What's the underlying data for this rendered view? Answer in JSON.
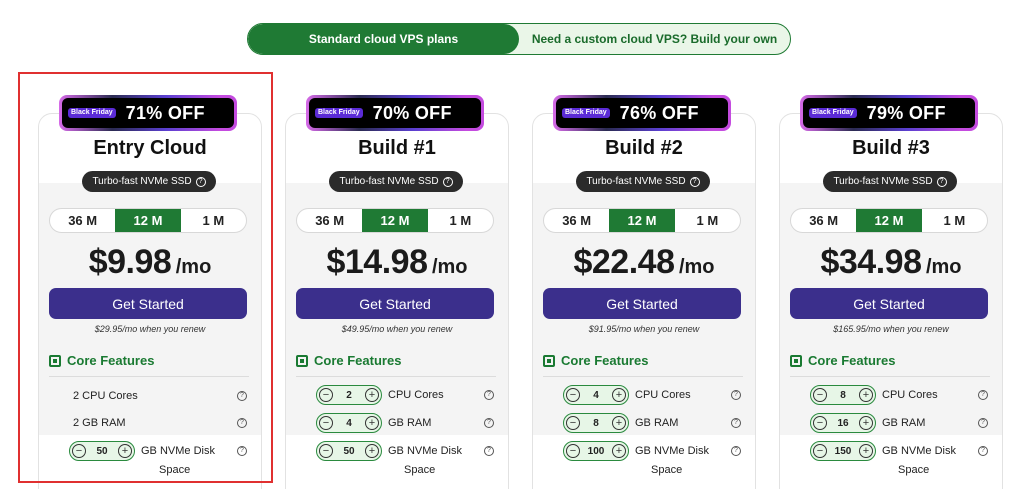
{
  "toggle": {
    "active": "Standard cloud VPS plans",
    "inactive": "Need a custom cloud VPS? Build your own"
  },
  "common": {
    "badge_label": "Black Friday",
    "ssd_label": "Turbo-fast NVMe SSD",
    "help_icon": "?",
    "terms": [
      "36 M",
      "12 M",
      "1 M"
    ],
    "selected_term": "12 M",
    "per_mo": "/mo",
    "cta": "Get Started",
    "core_features": "Core Features",
    "cpu_label": "CPU Cores",
    "ram_label": "GB RAM",
    "disk_label": "GB NVMe Disk",
    "disk_label2": "Space",
    "minus": "−",
    "plus": "+"
  },
  "plans": [
    {
      "off": "71% OFF",
      "name": "Entry Cloud",
      "price": "$9.98",
      "renew": "$29.95/mo when you renew",
      "cpu_text": "2 CPU Cores",
      "ram_text": "2 GB RAM",
      "disk": "50"
    },
    {
      "off": "70% OFF",
      "name": "Build #1",
      "price": "$14.98",
      "renew": "$49.95/mo when you renew",
      "cpu": "2",
      "ram": "4",
      "disk": "50"
    },
    {
      "off": "76% OFF",
      "name": "Build #2",
      "price": "$22.48",
      "renew": "$91.95/mo when you renew",
      "cpu": "4",
      "ram": "8",
      "disk": "100"
    },
    {
      "off": "79% OFF",
      "name": "Build #3",
      "price": "$34.98",
      "renew": "$165.95/mo when you renew",
      "cpu": "8",
      "ram": "16",
      "disk": "150"
    }
  ],
  "colors": {
    "green": "#1f7a34",
    "purple": "#3b2f8c",
    "highlight": "#e03030"
  }
}
